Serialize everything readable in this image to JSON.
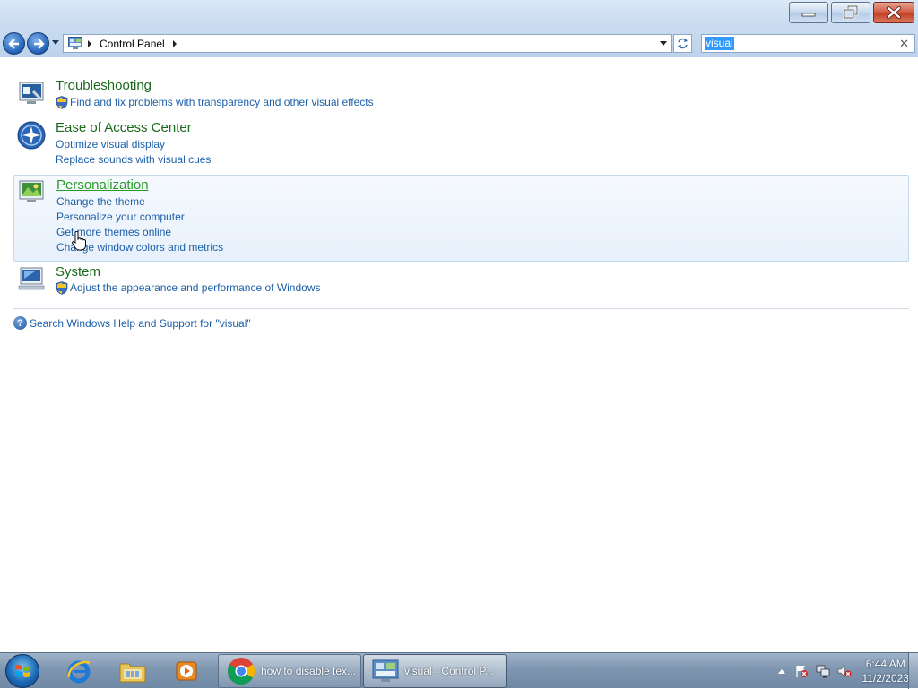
{
  "window": {
    "caption_buttons": [
      "minimize",
      "restore",
      "close"
    ]
  },
  "nav": {
    "breadcrumb": [
      "Control Panel"
    ],
    "search_value": "visual"
  },
  "results": [
    {
      "title": "Troubleshooting",
      "icon": "troubleshooting-icon",
      "links": [
        {
          "text": "Find and fix problems with transparency and other visual effects",
          "shield": true
        }
      ]
    },
    {
      "title": "Ease of Access Center",
      "icon": "ease-of-access-icon",
      "links": [
        {
          "text": "Optimize visual display",
          "shield": false
        },
        {
          "text": "Replace sounds with visual cues",
          "shield": false
        }
      ]
    },
    {
      "title": "Personalization",
      "icon": "personalization-icon",
      "hovered": true,
      "links": [
        {
          "text": "Change the theme",
          "shield": false
        },
        {
          "text": "Personalize your computer",
          "shield": false
        },
        {
          "text": "Get more themes online",
          "shield": false
        },
        {
          "text": "Change window colors and metrics",
          "shield": false
        }
      ]
    },
    {
      "title": "System",
      "icon": "system-icon",
      "links": [
        {
          "text": "Adjust the appearance and performance of Windows",
          "shield": true
        }
      ]
    }
  ],
  "help": {
    "text": "Search Windows Help and Support for \"visual\""
  },
  "taskbar": {
    "pinned": [
      "internet-explorer-icon",
      "windows-explorer-icon",
      "media-player-icon"
    ],
    "tasks": [
      {
        "label": "how to disable tex...",
        "icon": "chrome-icon",
        "active": false
      },
      {
        "label": "visual - Control P...",
        "icon": "control-panel-icon",
        "active": true
      }
    ],
    "clock": {
      "time": "6:44 AM",
      "date": "11/2/2023"
    }
  },
  "colors": {
    "title_green": "#1a6a1d",
    "link_blue": "#1c5fa9",
    "selection": "#3399ff"
  }
}
